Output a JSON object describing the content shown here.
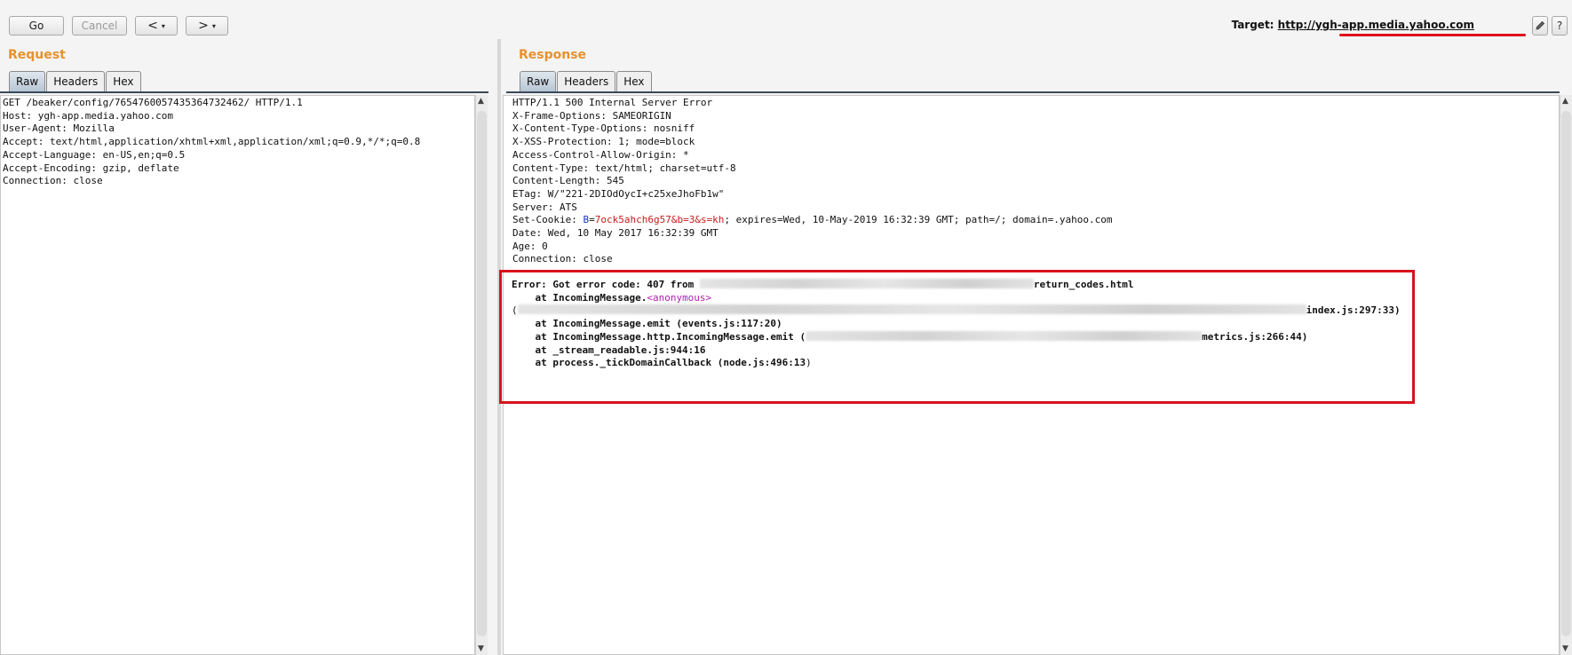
{
  "toolbar": {
    "go_label": "Go",
    "cancel_label": "Cancel",
    "back_label": "<",
    "forward_label": ">",
    "dropdown_glyph": "▾",
    "target_label": "Target:",
    "target_url": "http://ygh-app.media.yahoo.com",
    "edit_icon": "pencil-icon",
    "help_label": "?"
  },
  "request": {
    "title": "Request",
    "tabs": [
      "Raw",
      "Headers",
      "Hex"
    ],
    "active_tab": "Raw",
    "lines": [
      "GET /beaker/config/7654760057435364732462/ HTTP/1.1",
      "Host: ygh-app.media.yahoo.com",
      "User-Agent: Mozilla",
      "Accept: text/html,application/xhtml+xml,application/xml;q=0.9,*/*;q=0.8",
      "Accept-Language: en-US,en;q=0.5",
      "Accept-Encoding: gzip, deflate",
      "Connection: close"
    ]
  },
  "response": {
    "title": "Response",
    "tabs": [
      "Raw",
      "Headers",
      "Hex"
    ],
    "active_tab": "Raw",
    "lines": [
      "HTTP/1.1 500 Internal Server Error",
      "X-Frame-Options: SAMEORIGIN",
      "X-Content-Type-Options: nosniff",
      "X-XSS-Protection: 1; mode=block",
      "Access-Control-Allow-Origin: *",
      "Content-Type: text/html; charset=utf-8",
      "Content-Length: 545",
      "ETag: W/\"221-2DIOdOycI+c25xeJhoFb1w\"",
      "Server: ATS"
    ],
    "set_cookie_prefix": "Set-Cookie: ",
    "cookie_key": "B",
    "cookie_eq": "=",
    "cookie_value": "7ock5ahch6g57&b=3&s=kh",
    "cookie_rest": "; expires=Wed, 10-May-2019 16:32:39 GMT; path=/; domain=.yahoo.com",
    "lines_after": [
      "Date: Wed, 10 May 2017 16:32:39 GMT",
      "Age: 0",
      "Connection: close"
    ],
    "error": {
      "line1_prefix": "Error: Got error code: 407 from ",
      "line1_suffix": "return_codes.html",
      "line2_prefix": "    at IncomingMessage.",
      "line2_anon": "<anonymous>",
      "line3_open": "(",
      "line3_suffix": "index.js:297:33)",
      "line4": "    at IncomingMessage.emit (events.js:117:20)",
      "line5_prefix": "    at IncomingMessage.http.IncomingMessage.emit (",
      "line5_suffix": "metrics.js:266:44)",
      "line6": "    at _stream_readable.js:944:16",
      "line7_prefix": "    at process._tickDomainCallback (node.js:496:13",
      "line7_close": ")"
    }
  }
}
